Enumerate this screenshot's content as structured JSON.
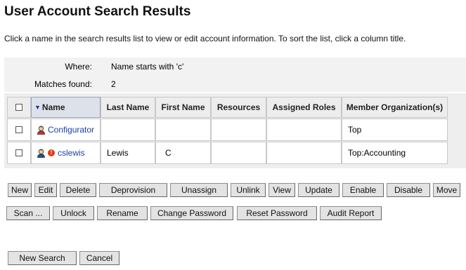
{
  "page": {
    "title": "User Account Search Results",
    "instructions": "Click a name in the search results list to view or edit account information. To sort the list, click a column title."
  },
  "summary": {
    "where_label": "Where:",
    "where_value": "Name starts with 'c'",
    "matches_label": "Matches found:",
    "matches_value": "2"
  },
  "table": {
    "headers": [
      "Name",
      "Last Name",
      "First Name",
      "Resources",
      "Assigned Roles",
      "Member Organization(s)"
    ],
    "sorted_column": "Name",
    "sort_direction": "descending",
    "rows": [
      {
        "name": "Configurator",
        "last_name": "",
        "first_name": "",
        "resources": "",
        "assigned_roles": "",
        "organization": "Top",
        "icon": "user-icon",
        "warning": false
      },
      {
        "name": "cslewis",
        "last_name": "Lewis",
        "first_name": "C",
        "resources": "",
        "assigned_roles": "",
        "organization": "Top:Accounting",
        "icon": "user-icon",
        "warning": true
      }
    ],
    "warning_glyph": "!"
  },
  "actions_row1": [
    "New",
    "Edit",
    "Delete",
    "Deprovision",
    "Unassign",
    "Unlink",
    "View",
    "Update",
    "Enable",
    "Disable",
    "Move"
  ],
  "actions_row2": [
    "Scan ...",
    "Unlock",
    "Rename",
    "Change Password",
    "Reset Password",
    "Audit Report"
  ],
  "footer_buttons": {
    "new_search": "New Search",
    "cancel": "Cancel"
  },
  "colors": {
    "link": "#1a3fa8",
    "sort_arrow": "#1a3f8f",
    "warning": "#e23b10"
  }
}
